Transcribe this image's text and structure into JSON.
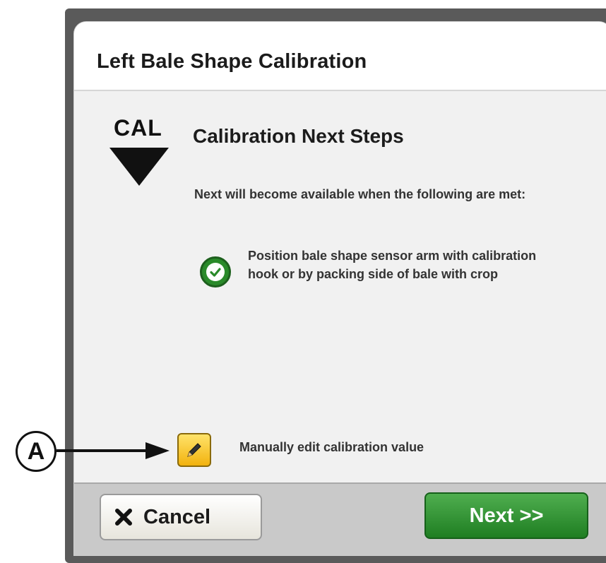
{
  "dialog": {
    "title": "Left Bale Shape Calibration",
    "cal_label": "CAL",
    "heading": "Calibration Next Steps",
    "info_text": "Next will become available when the following are met:",
    "conditions": [
      {
        "text": "Position bale shape sensor arm with calibration hook or by packing side of bale with crop",
        "status": "met"
      }
    ],
    "edit_label": "Manually edit calibration value"
  },
  "footer": {
    "cancel_label": "Cancel",
    "next_label": "Next >>"
  },
  "callout": {
    "label": "A"
  },
  "colors": {
    "next_green": "#1f7e22",
    "check_green": "#2a8a2a",
    "edit_yellow": "#f2b20e"
  }
}
